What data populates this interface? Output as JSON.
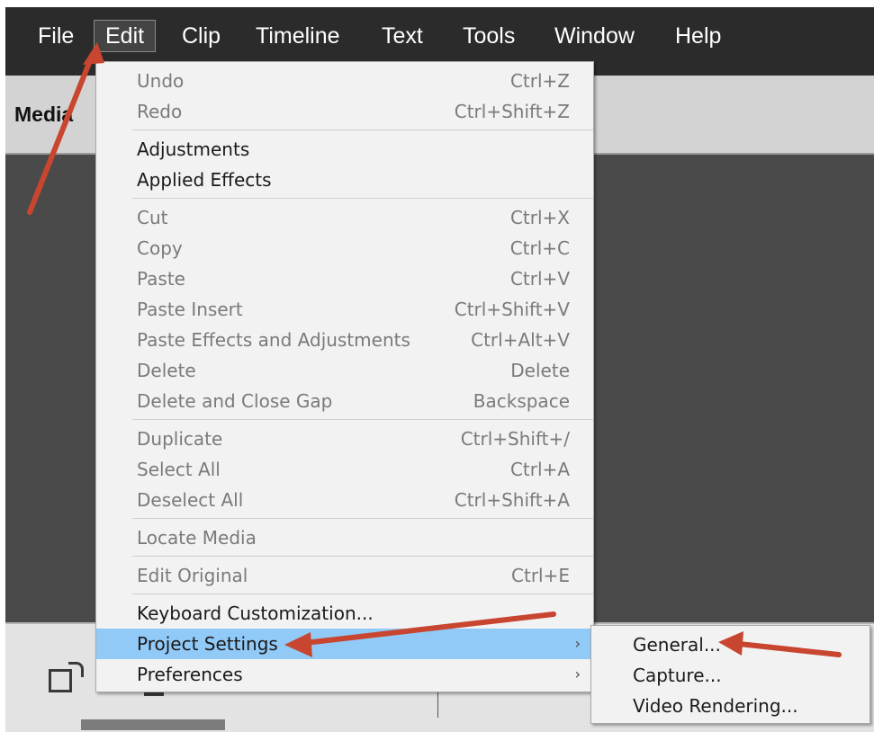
{
  "menubar": {
    "items": [
      {
        "label": "File"
      },
      {
        "label": "Edit"
      },
      {
        "label": "Clip"
      },
      {
        "label": "Timeline"
      },
      {
        "label": "Text"
      },
      {
        "label": "Tools"
      },
      {
        "label": "Window"
      },
      {
        "label": "Help"
      }
    ]
  },
  "panel": {
    "title": "Media"
  },
  "edit_menu": {
    "items": [
      {
        "label": "Undo",
        "shortcut": "Ctrl+Z"
      },
      {
        "label": "Redo",
        "shortcut": "Ctrl+Shift+Z"
      },
      {
        "label": "Adjustments",
        "shortcut": ""
      },
      {
        "label": "Applied Effects",
        "shortcut": ""
      },
      {
        "label": "Cut",
        "shortcut": "Ctrl+X"
      },
      {
        "label": "Copy",
        "shortcut": "Ctrl+C"
      },
      {
        "label": "Paste",
        "shortcut": "Ctrl+V"
      },
      {
        "label": "Paste Insert",
        "shortcut": "Ctrl+Shift+V"
      },
      {
        "label": "Paste Effects and Adjustments",
        "shortcut": "Ctrl+Alt+V"
      },
      {
        "label": "Delete",
        "shortcut": "Delete"
      },
      {
        "label": "Delete and Close Gap",
        "shortcut": "Backspace"
      },
      {
        "label": "Duplicate",
        "shortcut": "Ctrl+Shift+/"
      },
      {
        "label": "Select All",
        "shortcut": "Ctrl+A"
      },
      {
        "label": "Deselect All",
        "shortcut": "Ctrl+Shift+A"
      },
      {
        "label": "Locate Media",
        "shortcut": ""
      },
      {
        "label": "Edit Original",
        "shortcut": "Ctrl+E"
      },
      {
        "label": "Keyboard Customization...",
        "shortcut": ""
      },
      {
        "label": "Project Settings",
        "shortcut": "",
        "submenu_arrow": "›"
      },
      {
        "label": "Preferences",
        "shortcut": "",
        "submenu_arrow": "›"
      }
    ]
  },
  "project_settings_submenu": {
    "items": [
      {
        "label": "General..."
      },
      {
        "label": "Capture..."
      },
      {
        "label": "Video Rendering..."
      }
    ]
  },
  "colors": {
    "menubar_bg": "#2b2b2b",
    "menu_bg": "#f2f2f2",
    "highlight": "#91c9f7",
    "annotation_arrow": "#c8452f"
  }
}
